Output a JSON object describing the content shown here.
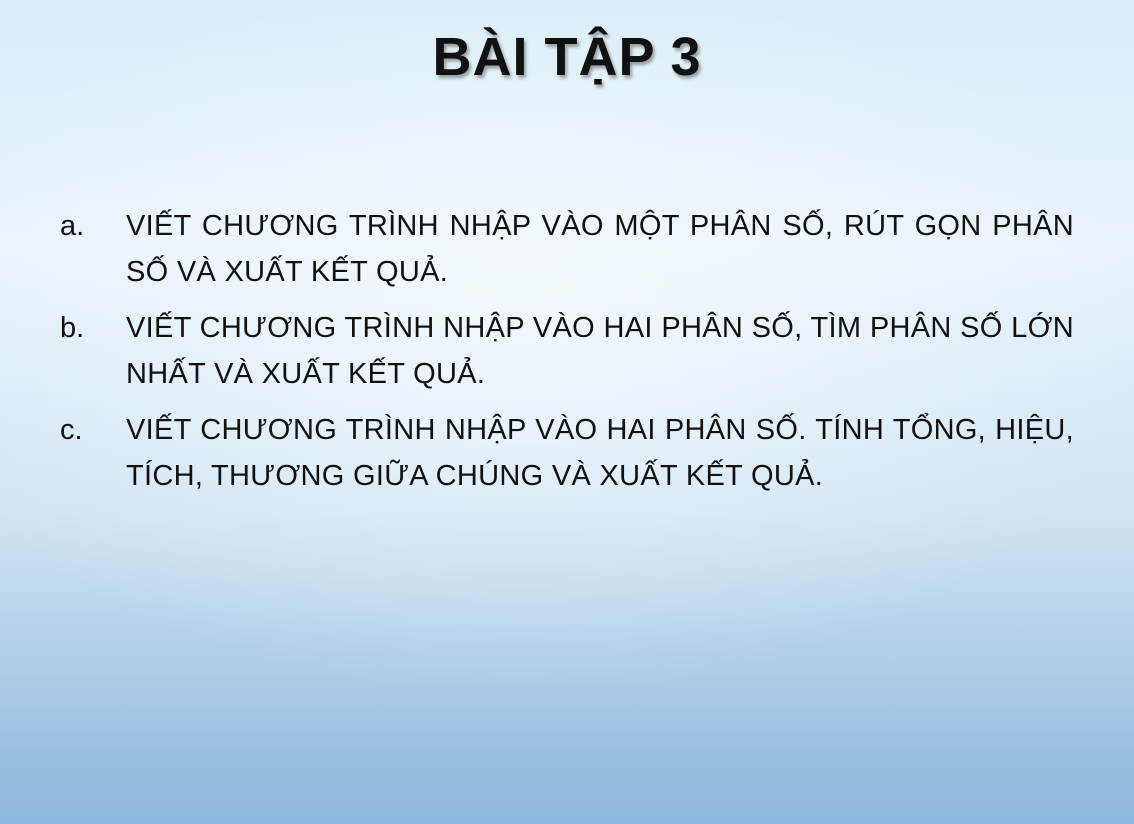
{
  "slide": {
    "title": "BÀI TẬP 3",
    "items": [
      {
        "marker": "a.",
        "text": "VIẾT CHƯƠNG TRÌNH NHẬP VÀO MỘT PHÂN SỐ, RÚT GỌN PHÂN SỐ VÀ XUẤT KẾT QUẢ."
      },
      {
        "marker": "b.",
        "text": "VIẾT CHƯƠNG TRÌNH NHẬP VÀO HAI PHÂN SỐ, TÌM PHÂN SỐ LỚN NHẤT VÀ XUẤT KẾT QUẢ."
      },
      {
        "marker": "c.",
        "text": "VIẾT CHƯƠNG TRÌNH NHẬP VÀO HAI PHÂN SỐ. TÍNH TỔNG, HIỆU, TÍCH, THƯƠNG GIỮA CHÚNG VÀ XUẤT KẾT QUẢ."
      }
    ]
  },
  "colors": {
    "text": "#111111",
    "background_top": "#d9ecf7",
    "background_bottom": "#8bb6dc"
  }
}
